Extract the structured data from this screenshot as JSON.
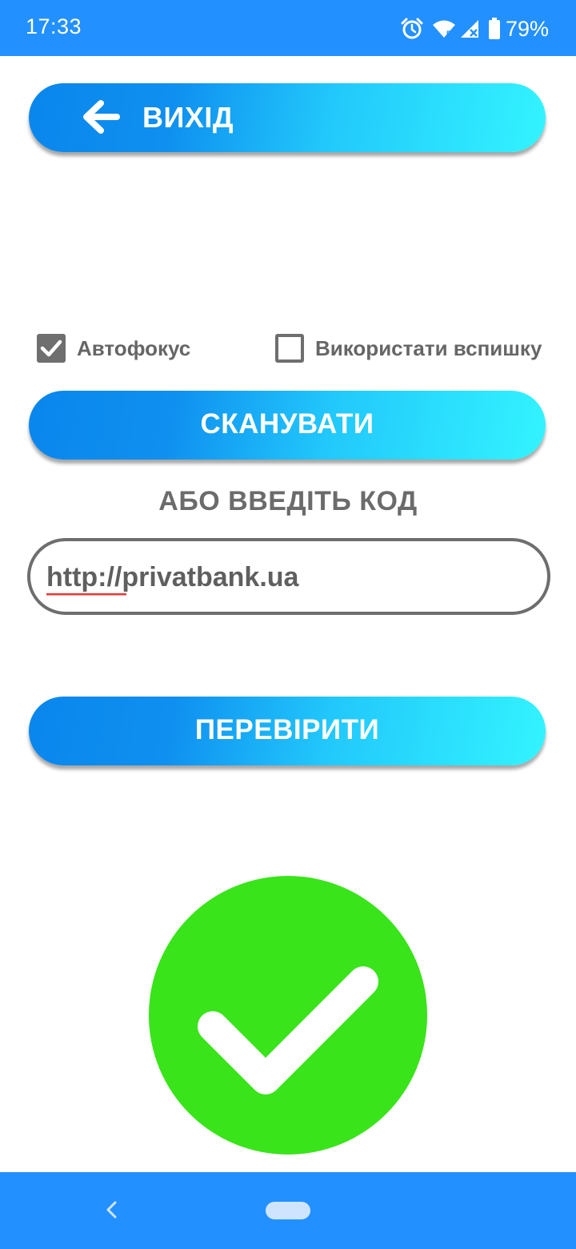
{
  "status_bar": {
    "time": "17:33",
    "battery_percent": "79%",
    "icons": [
      "alarm-icon",
      "wifi-icon",
      "signal-icon",
      "battery-icon"
    ]
  },
  "exit_button": {
    "label": "ВИХІД",
    "icon": "arrow-left-icon"
  },
  "options": {
    "autofocus": {
      "label": "Автофокус",
      "checked": true
    },
    "flash": {
      "label": "Використати вспишку",
      "checked": false
    }
  },
  "scan_button": {
    "label": "СКАНУВАТИ"
  },
  "or_label": "АБО ВВЕДІТЬ КОД",
  "code_input": {
    "value": "http://privatbank.ua"
  },
  "check_button": {
    "label": "ПЕРЕВІРИТИ"
  },
  "result": {
    "icon": "success-check-icon",
    "color": "#39e41a"
  },
  "colors": {
    "accent": "#2390ff",
    "gradient_start": "#0a86ec",
    "gradient_end": "#33f4ff",
    "text_gray": "#6b6b6b"
  },
  "nav_bar": {
    "icons": [
      "back-icon",
      "home-pill"
    ]
  }
}
